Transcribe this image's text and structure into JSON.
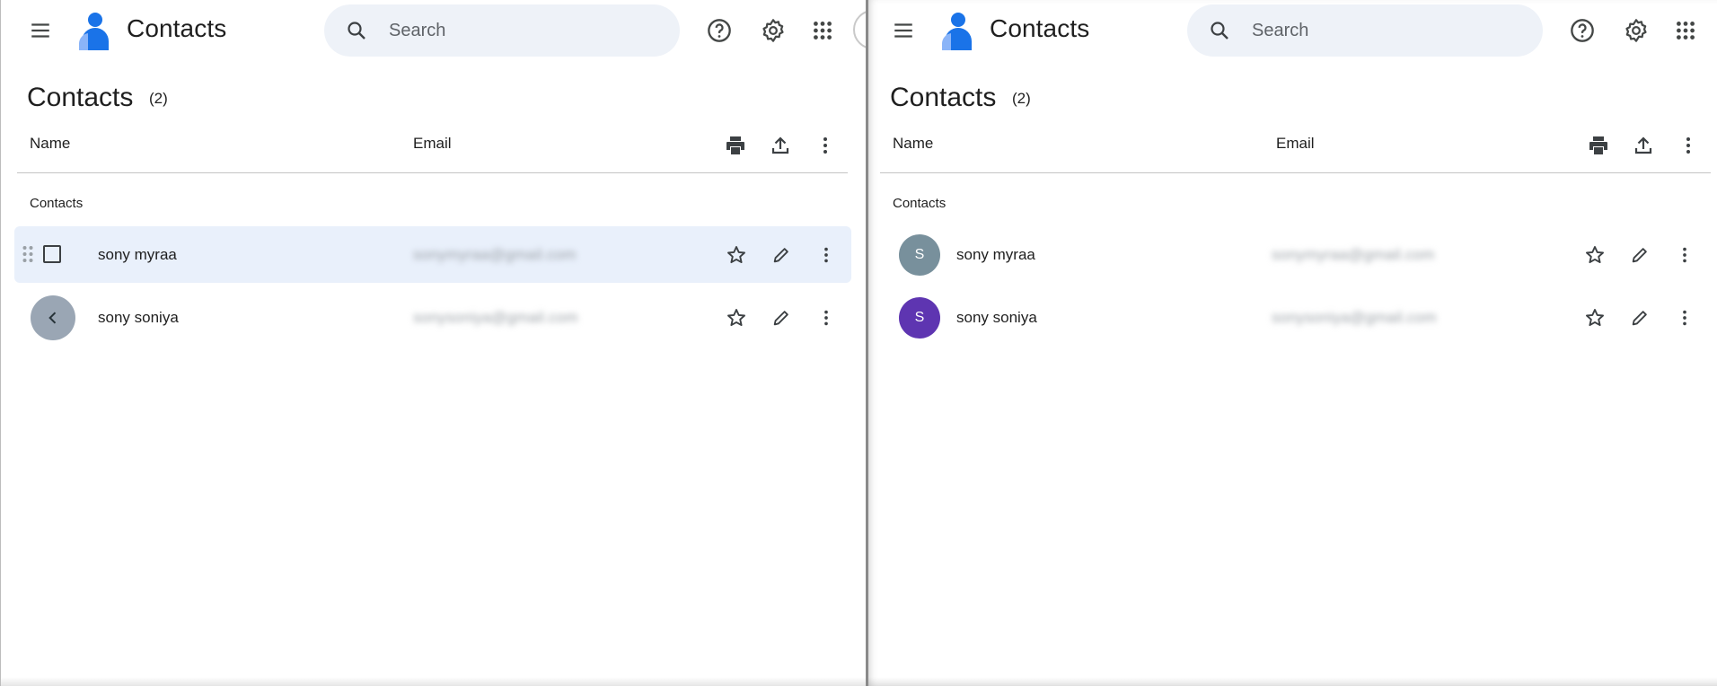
{
  "app": {
    "title": "Contacts",
    "search_placeholder": "Search",
    "page_title": "Contacts",
    "count": "(2)",
    "columns": {
      "name": "Name",
      "email": "Email"
    },
    "section_label": "Contacts",
    "brand_color": "#1a73e8"
  },
  "icons": {
    "menu": "hamburger-menu",
    "help": "help-circle",
    "settings": "gear",
    "apps": "apps-grid",
    "search": "magnifier",
    "print": "printer",
    "export": "upload",
    "more": "vertical-dots",
    "star": "star-outline",
    "edit": "pencil",
    "back": "chevron-left"
  },
  "left_pane": {
    "contacts": [
      {
        "name": "sony myraa",
        "email": "sonymyraa@gmail.com",
        "selected": true
      },
      {
        "name": "sony soniya",
        "email": "sonysoniya@gmail.com",
        "selected": false
      }
    ]
  },
  "right_pane": {
    "contacts": [
      {
        "name": "sony myraa",
        "email": "sonymyraa@gmail.com",
        "initial": "S",
        "avatar_color": "#78909c"
      },
      {
        "name": "sony soniya",
        "email": "sonysoniya@gmail.com",
        "initial": "S",
        "avatar_color": "#5e35b1"
      }
    ]
  }
}
